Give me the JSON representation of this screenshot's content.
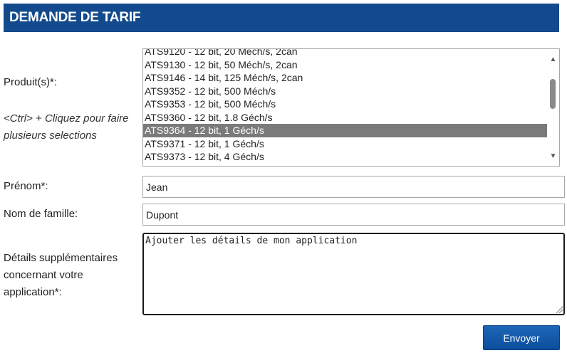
{
  "header": {
    "title": "DEMANDE DE TARIF"
  },
  "form": {
    "products_label": "Produit(s)*:",
    "products_hint": "<Ctrl> + Cliquez pour faire plusieurs selections",
    "products_options": [
      "ATS9120 - 12 bit, 20 Méch/s, 2can",
      "ATS9130 - 12 bit, 50 Méch/s, 2can",
      "ATS9146 - 14 bit, 125 Méch/s, 2can",
      "ATS9352 - 12 bit, 500 Méch/s",
      "ATS9353 - 12 bit, 500 Méch/s",
      "ATS9360 - 12 bit, 1.8 Géch/s",
      "ATS9364 - 12 bit, 1 Géch/s",
      "ATS9371 - 12 bit, 1 Géch/s",
      "ATS9373 - 12 bit, 4 Géch/s"
    ],
    "products_selected": "ATS9364 - 12 bit, 1 Géch/s",
    "firstname_label": "Prénom*:",
    "firstname_value": "Jean",
    "lastname_label": "Nom de famille:",
    "lastname_value": "Dupont",
    "details_label": "Détails supplémentaires concernant votre application*:",
    "details_value": "Ajouter les détails de mon application",
    "submit_label": "Envoyer"
  },
  "colors": {
    "header_bg": "#134a8e",
    "button_bg": "#1d66b8",
    "selected_option_bg": "#7a7a7a"
  },
  "icons": {
    "scroll_up": "triangle-up-icon",
    "scroll_down": "triangle-down-icon"
  }
}
